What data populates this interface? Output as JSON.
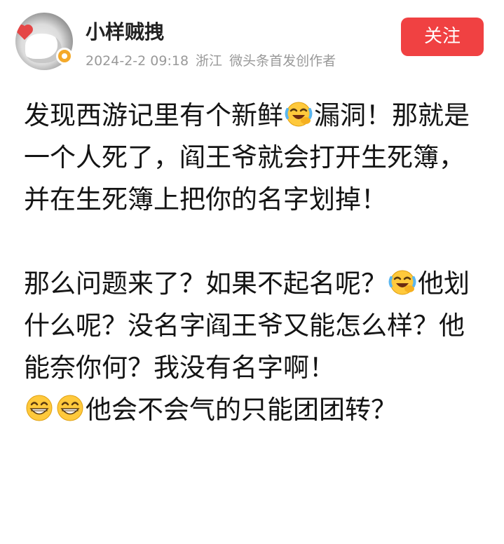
{
  "post": {
    "author": {
      "name": "小样贼拽",
      "avatar_icon": "avatar-hands-heart-icon",
      "verified_icon": "verified-badge-icon"
    },
    "meta": {
      "date": "2024-2-2 09:18",
      "location": "浙江",
      "badge": "微头条首发创作者"
    },
    "follow_label": "关注",
    "colors": {
      "follow_bg": "#f04142",
      "meta_text": "#999999",
      "emoji_yellow": "#ffc93c"
    },
    "body": {
      "p1": {
        "s1": "发现西游记里有个新鲜",
        "emoji1": "laughing-crying-emoji-icon",
        "s2": "漏洞！那就是一个人死了，阎王爷就会打开生死簿，并在生死簿上把你的名字划掉！"
      },
      "p2": {
        "s1": "那么问题来了？如果不起名呢？",
        "emoji1": "laughing-crying-emoji-icon",
        "s2": "他划什么呢？没名字阎王爷又能怎么样？他能奈你何？我没有名字啊！",
        "emoji2": "grinning-emoji-icon",
        "emoji3": "grinning-emoji-icon",
        "s3": "他会不会气的只能团团转？"
      }
    }
  }
}
